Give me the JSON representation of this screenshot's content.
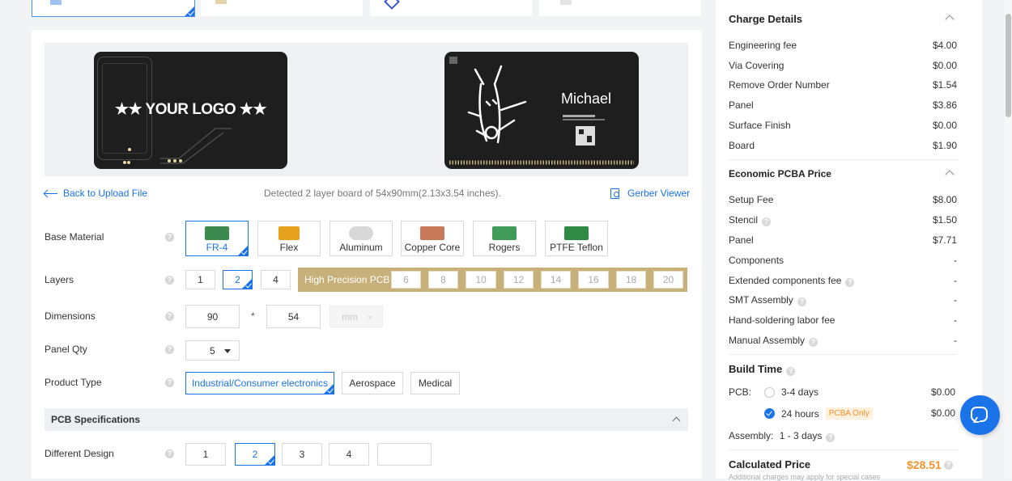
{
  "preview": {
    "back_link": "Back to Upload File",
    "detected": "Detected 2 layer board of 54x90mm(2.13x3.54 inches).",
    "gerber_viewer": "Gerber Viewer",
    "front_logo_text": "★★ YOUR LOGO ★★",
    "back_name": "Michael"
  },
  "form": {
    "base_material": {
      "label": "Base Material",
      "options": [
        "FR-4",
        "Flex",
        "Aluminum",
        "Copper Core",
        "Rogers",
        "PTFE Teflon"
      ],
      "selected": "FR-4"
    },
    "layers": {
      "label": "Layers",
      "options": [
        "1",
        "2",
        "4"
      ],
      "selected": "2",
      "high_precision_label": "High Precision PCB",
      "high_precision_options": [
        "6",
        "8",
        "10",
        "12",
        "14",
        "16",
        "18",
        "20"
      ]
    },
    "dimensions": {
      "label": "Dimensions",
      "width": "90",
      "times": "*",
      "height": "54",
      "unit": "mm"
    },
    "panel_qty": {
      "label": "Panel Qty",
      "value": "5"
    },
    "product_type": {
      "label": "Product Type",
      "options": [
        "Industrial/Consumer electronics",
        "Aerospace",
        "Medical"
      ],
      "selected": "Industrial/Consumer electronics"
    },
    "pcb_specs": {
      "title": "PCB Specifications"
    },
    "different_design": {
      "label": "Different Design",
      "options": [
        "1",
        "2",
        "3",
        "4"
      ],
      "selected": "2",
      "custom_value": ""
    }
  },
  "charge_details": {
    "title": "Charge Details",
    "items": [
      {
        "label": "Engineering fee",
        "value": "$4.00"
      },
      {
        "label": "Via Covering",
        "value": "$0.00"
      },
      {
        "label": "Remove Order Number",
        "value": "$1.54"
      },
      {
        "label": "Panel",
        "value": "$3.86"
      },
      {
        "label": "Surface Finish",
        "value": "$0.00"
      },
      {
        "label": "Board",
        "value": "$1.90"
      }
    ]
  },
  "pcba_price": {
    "title": "Economic PCBA Price",
    "items": [
      {
        "label": "Setup Fee",
        "value": "$8.00"
      },
      {
        "label": "Stencil",
        "value": "$1.50",
        "help": true
      },
      {
        "label": "Panel",
        "value": "$7.71"
      },
      {
        "label": "Components",
        "value": "-"
      },
      {
        "label": "Extended components fee",
        "value": "-",
        "help": true
      },
      {
        "label": "SMT Assembly",
        "value": "-",
        "help": true
      },
      {
        "label": "Hand-soldering labor fee",
        "value": "-"
      },
      {
        "label": "Manual Assembly",
        "value": "-",
        "help": true
      }
    ]
  },
  "build_time": {
    "title": "Build Time",
    "pcb_label": "PCB:",
    "options": [
      {
        "label": "3-4 days",
        "value": "$0.00",
        "checked": false
      },
      {
        "label": "24 hours",
        "value": "$0.00",
        "checked": true,
        "badge": "PCBA Only"
      }
    ],
    "assembly_label": "Assembly:",
    "assembly_value": "1 - 3 days"
  },
  "calculated_price": {
    "label": "Calculated Price",
    "value": "$28.51",
    "note": "Additional charges may apply for special cases"
  },
  "colors": {
    "accent": "#1a73e8",
    "price": "#f5922b",
    "gold": "#c8b07a",
    "chat": "#1a73e8"
  }
}
